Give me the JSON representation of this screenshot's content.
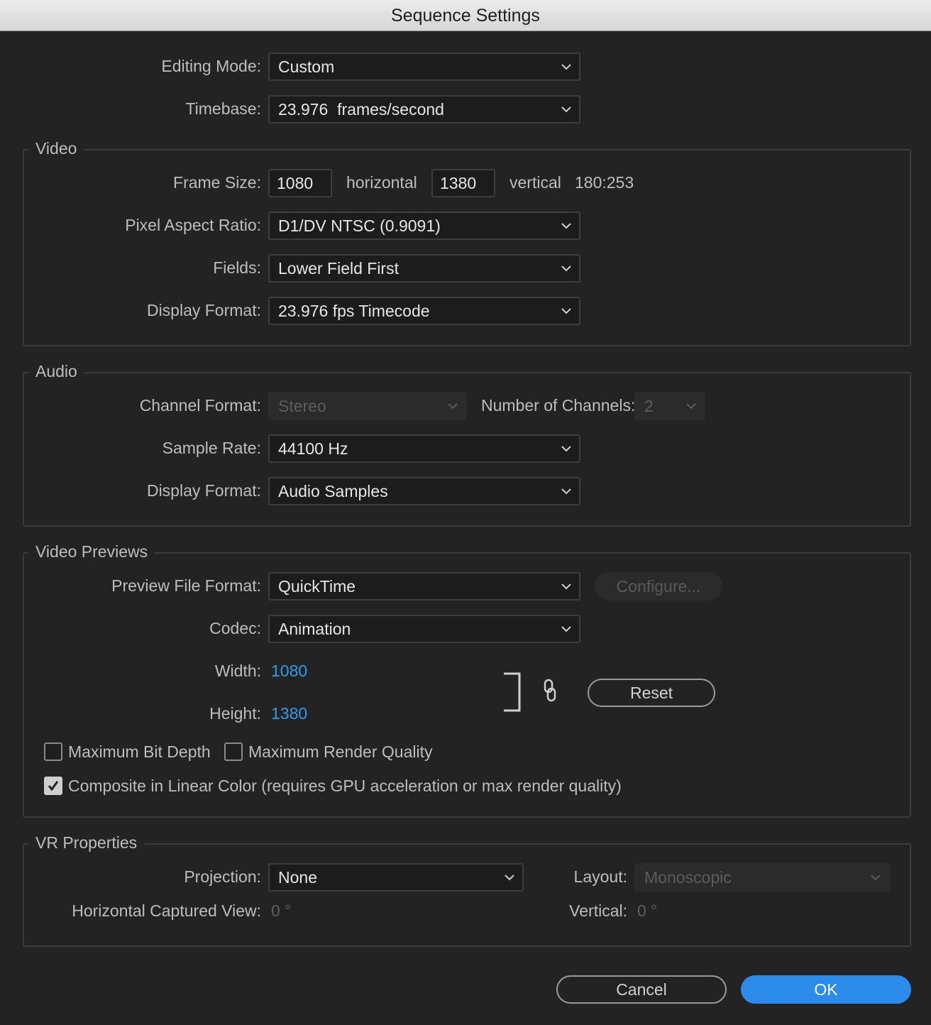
{
  "window": {
    "title": "Sequence Settings"
  },
  "general": {
    "editing_mode_label": "Editing Mode:",
    "editing_mode_value": "Custom",
    "timebase_label": "Timebase:",
    "timebase_value": "23.976  frames/second"
  },
  "video": {
    "section_title": "Video",
    "frame_size_label": "Frame Size:",
    "frame_width": "1080",
    "horizontal_label": "horizontal",
    "frame_height": "1380",
    "vertical_label": "vertical",
    "aspect": "180:253",
    "pixel_aspect_label": "Pixel Aspect Ratio:",
    "pixel_aspect_value": "D1/DV NTSC (0.9091)",
    "fields_label": "Fields:",
    "fields_value": "Lower Field First",
    "display_format_label": "Display Format:",
    "display_format_value": "23.976 fps Timecode"
  },
  "audio": {
    "section_title": "Audio",
    "channel_format_label": "Channel Format:",
    "channel_format_value": "Stereo",
    "num_channels_label": "Number of Channels:",
    "num_channels_value": "2",
    "sample_rate_label": "Sample Rate:",
    "sample_rate_value": "44100 Hz",
    "display_format_label": "Display Format:",
    "display_format_value": "Audio Samples"
  },
  "previews": {
    "section_title": "Video Previews",
    "file_format_label": "Preview File Format:",
    "file_format_value": "QuickTime",
    "configure_label": "Configure...",
    "codec_label": "Codec:",
    "codec_value": "Animation",
    "width_label": "Width:",
    "width_value": "1080",
    "height_label": "Height:",
    "height_value": "1380",
    "reset_label": "Reset",
    "max_bit_depth_label": "Maximum Bit Depth",
    "max_render_quality_label": "Maximum Render Quality",
    "composite_linear_label": "Composite in Linear Color (requires GPU acceleration or max render quality)",
    "max_bit_depth_checked": false,
    "max_render_quality_checked": false,
    "composite_linear_checked": true
  },
  "vr": {
    "section_title": "VR Properties",
    "projection_label": "Projection:",
    "projection_value": "None",
    "layout_label": "Layout:",
    "layout_value": "Monoscopic",
    "h_view_label": "Horizontal Captured View:",
    "h_view_value": "0 °",
    "vertical_label": "Vertical:",
    "vertical_value": "0 °"
  },
  "footer": {
    "cancel_label": "Cancel",
    "ok_label": "OK"
  },
  "colors": {
    "background": "#232323",
    "accent": "#2d8ceb",
    "link_value": "#2d9bf0"
  }
}
